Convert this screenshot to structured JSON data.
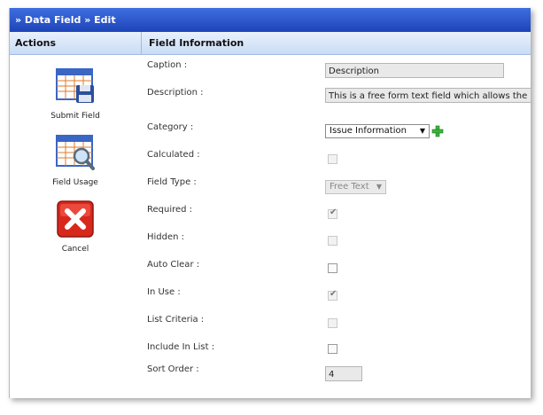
{
  "title": "» Data Field » Edit",
  "headers": {
    "actions": "Actions",
    "field_information": "Field Information"
  },
  "actions": [
    {
      "label": "Submit Field",
      "icon": "submit-field-icon"
    },
    {
      "label": "Field Usage",
      "icon": "field-usage-icon"
    },
    {
      "label": "Cancel",
      "icon": "cancel-icon"
    }
  ],
  "fields": {
    "caption": {
      "label": "Caption :",
      "value": "Description"
    },
    "description": {
      "label": "Description :",
      "value": "This is a free form text field which allows the"
    },
    "category": {
      "label": "Category :",
      "value": "Issue Information"
    },
    "calculated": {
      "label": "Calculated :",
      "checked": false
    },
    "field_type": {
      "label": "Field Type :",
      "value": "Free Text"
    },
    "required": {
      "label": "Required :",
      "checked": true
    },
    "hidden": {
      "label": "Hidden :",
      "checked": false
    },
    "auto_clear": {
      "label": "Auto Clear :",
      "checked": false
    },
    "in_use": {
      "label": "In Use :",
      "checked": true
    },
    "list_criteria": {
      "label": "List Criteria :",
      "checked": false
    },
    "include_in_list": {
      "label": "Include In List :",
      "checked": false
    },
    "sort_order": {
      "label": "Sort Order :",
      "value": "4"
    }
  },
  "colors": {
    "title_bar": "#2a55c9",
    "header_bg": "#d8e6f8",
    "cancel_red": "#d8281c",
    "plus_green": "#3bb43b"
  }
}
